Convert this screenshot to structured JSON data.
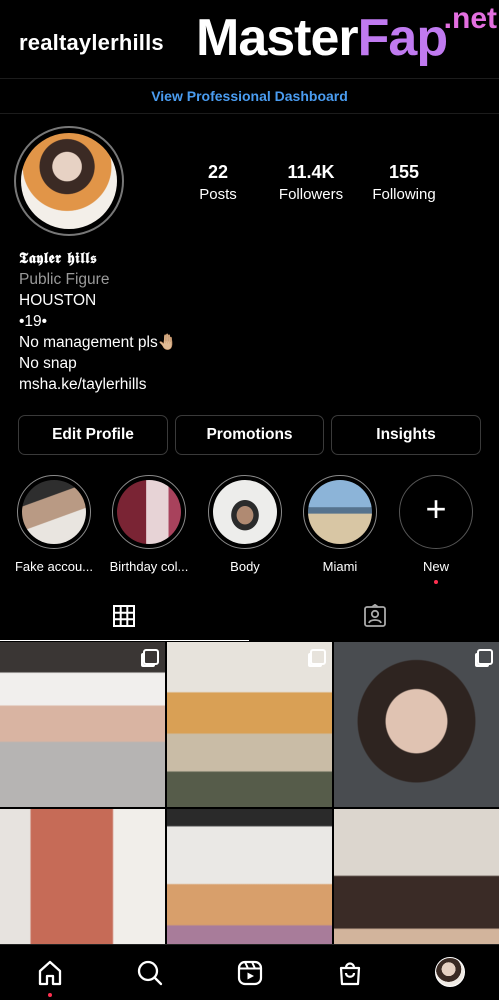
{
  "header": {
    "username": "realtaylerhills",
    "watermark_master": "Master",
    "watermark_fap": "Fap",
    "watermark_net": ".net"
  },
  "dashboard": {
    "label": "View Professional Dashboard"
  },
  "stats": [
    {
      "value": "22",
      "label": "Posts"
    },
    {
      "value": "11.4K",
      "label": "Followers"
    },
    {
      "value": "155",
      "label": "Following"
    }
  ],
  "bio": {
    "name": "𝕿𝖆𝖞𝖑𝖊𝖗 𝖍𝖎𝖑𝖑𝖘",
    "category": "Public Figure",
    "lines": [
      "HOUSTON",
      "•19•",
      "No management pls🤚🏼",
      "No snap"
    ],
    "link": "msha.ke/taylerhills"
  },
  "buttons": {
    "edit": "Edit Profile",
    "promotions": "Promotions",
    "insights": "Insights"
  },
  "highlights": [
    {
      "label": "Fake accou..."
    },
    {
      "label": "Birthday col..."
    },
    {
      "label": "Body"
    },
    {
      "label": "Miami"
    },
    {
      "label": "New"
    }
  ],
  "colors": {
    "link": "#4a9cf0",
    "notify_dot": "#ff3050",
    "background": "#000000"
  },
  "icons": {
    "tabs": [
      "grid-icon",
      "tagged-icon"
    ],
    "nav": [
      "home-icon",
      "search-icon",
      "reels-icon",
      "shop-icon",
      "profile-avatar"
    ]
  }
}
